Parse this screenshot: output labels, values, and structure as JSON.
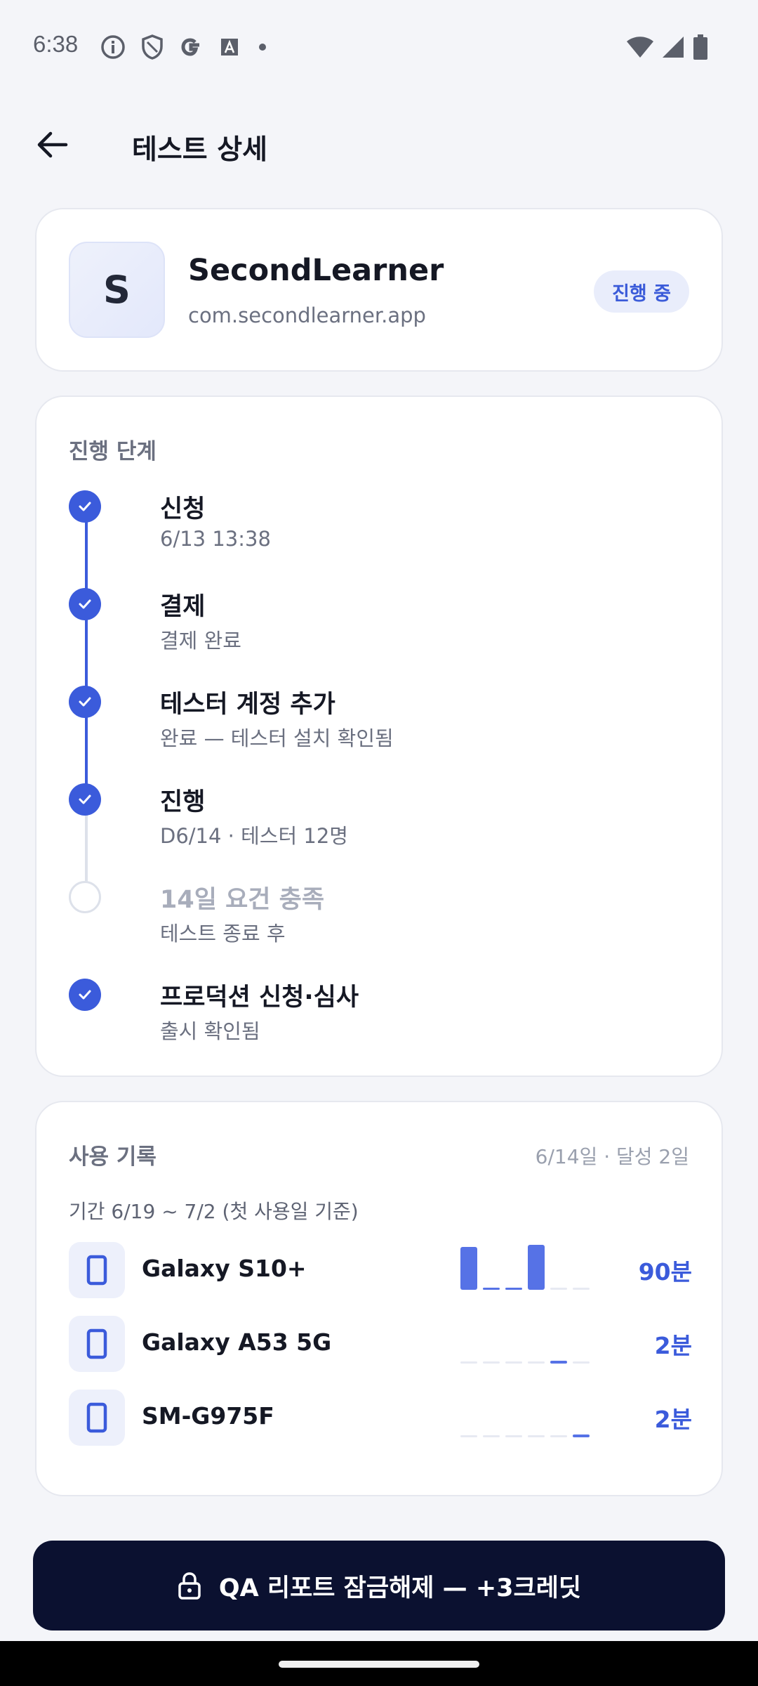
{
  "status_bar": {
    "time": "6:38",
    "icons_left": [
      "info-icon",
      "shield-icon",
      "google-icon",
      "font-icon",
      "dot-icon"
    ],
    "icons_right": [
      "wifi-icon",
      "signal-icon",
      "battery-icon"
    ]
  },
  "header": {
    "back_icon": "arrow-left-icon",
    "title": "테스트 상세"
  },
  "app": {
    "avatar_letter": "S",
    "name": "SecondLearner",
    "package": "com.secondlearner.app",
    "status": "진행 중"
  },
  "progress": {
    "label": "진행 단계",
    "steps": [
      {
        "title": "신청",
        "sub": "6/13 13:38",
        "done": true
      },
      {
        "title": "결제",
        "sub": "결제 완료",
        "done": true
      },
      {
        "title": "테스터 계정 추가",
        "sub": "완료 — 테스터 설치 확인됨",
        "done": true
      },
      {
        "title": "진행",
        "sub": "D6/14 · 테스터 12명",
        "done": true
      },
      {
        "title": "14일 요건 충족",
        "sub": "테스트 종료 후",
        "done": false
      },
      {
        "title": "프로덕션 신청·심사",
        "sub": "출시 확인됨",
        "done": true
      }
    ]
  },
  "usage": {
    "label": "사용 기록",
    "meta": "6/14일 · 달성 2일",
    "period": "기간 6/19 ~ 7/2 (첫 사용일 기준)",
    "devices": [
      {
        "name": "Galaxy S10+",
        "minutes": "90분",
        "daily_levels": [
          0.95,
          0.05,
          0.05,
          1.0,
          0.03,
          0.03
        ]
      },
      {
        "name": "Galaxy A53 5G",
        "minutes": "2분",
        "daily_levels": [
          0.03,
          0.03,
          0.03,
          0.03,
          0.06,
          0.03
        ]
      },
      {
        "name": "SM-G975F",
        "minutes": "2분",
        "daily_levels": [
          0.03,
          0.03,
          0.03,
          0.03,
          0.03,
          0.06
        ]
      }
    ]
  },
  "cta": {
    "icon": "lock-icon",
    "label": "QA 리포트 잠금해제 — +3크레딧"
  },
  "colors": {
    "accent": "#3b5bdb",
    "background": "#f4f5f9",
    "cta_background": "#0b1130"
  }
}
